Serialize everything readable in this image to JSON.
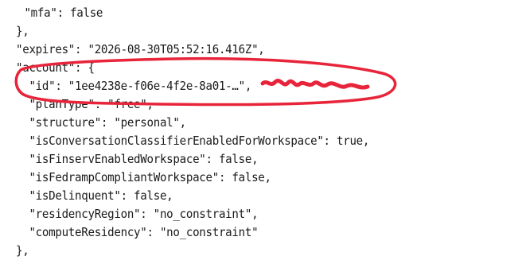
{
  "editor": {
    "lines": [
      {
        "text": "  \"mfa\": false"
      },
      {
        "text": "},"
      },
      {
        "text": "\"expires\": \"2026-08-30T05:52:16.416Z\","
      },
      {
        "text": "\"account\": {"
      },
      {
        "text": "  \"id\": \"1ee4238e-f06e-4f2e-8a01-…\","
      },
      {
        "text": "  \"planType\": \"free\","
      },
      {
        "text": "  \"structure\": \"personal\","
      },
      {
        "text": "  \"isConversationClassifierEnabledForWorkspace\": true,"
      },
      {
        "text": "  \"isFinservEnabledWorkspace\": false,"
      },
      {
        "text": "  \"isFedrampCompliantWorkspace\": false,"
      },
      {
        "text": "  \"isDelinquent\": false,"
      },
      {
        "text": "  \"residencyRegion\": \"no_constraint\","
      },
      {
        "text": "  \"computeResidency\": \"no_constraint\""
      },
      {
        "text": "},"
      }
    ]
  },
  "annotation": {
    "stroke_color": "#e8243a"
  }
}
